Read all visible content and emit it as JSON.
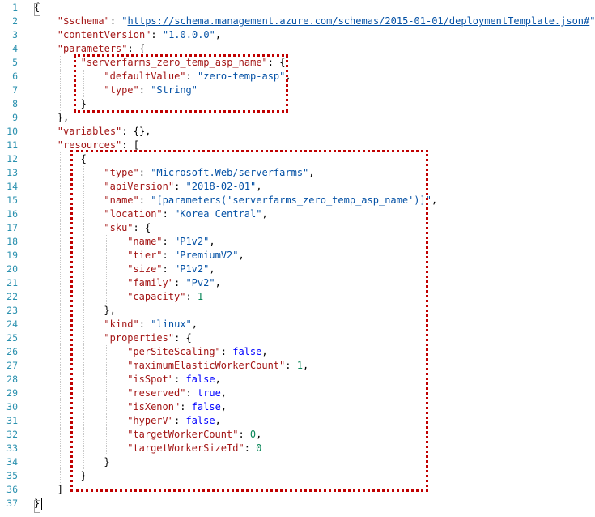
{
  "editor": {
    "language": "json",
    "line_numbers": [
      "1",
      "2",
      "3",
      "4",
      "5",
      "6",
      "7",
      "8",
      "9",
      "10",
      "11",
      "12",
      "13",
      "14",
      "15",
      "16",
      "17",
      "18",
      "19",
      "20",
      "21",
      "22",
      "23",
      "24",
      "25",
      "26",
      "27",
      "28",
      "29",
      "30",
      "31",
      "32",
      "33",
      "34",
      "35",
      "36",
      "37"
    ],
    "lines": [
      {
        "indent": 0,
        "tokens": [
          {
            "t": "p",
            "v": "{"
          }
        ]
      },
      {
        "indent": 1,
        "tokens": [
          {
            "t": "key",
            "v": "\"$schema\""
          },
          {
            "t": "p",
            "v": ": "
          },
          {
            "t": "str",
            "v": "\""
          },
          {
            "t": "url",
            "v": "https://schema.management.azure.com/schemas/2015-01-01/deploymentTemplate.json#"
          },
          {
            "t": "str",
            "v": "\""
          },
          {
            "t": "p",
            "v": ","
          }
        ]
      },
      {
        "indent": 1,
        "tokens": [
          {
            "t": "key",
            "v": "\"contentVersion\""
          },
          {
            "t": "p",
            "v": ": "
          },
          {
            "t": "str",
            "v": "\"1.0.0.0\""
          },
          {
            "t": "p",
            "v": ","
          }
        ]
      },
      {
        "indent": 1,
        "tokens": [
          {
            "t": "key",
            "v": "\"parameters\""
          },
          {
            "t": "p",
            "v": ": {"
          }
        ]
      },
      {
        "indent": 2,
        "tokens": [
          {
            "t": "key",
            "v": "\"serverfarms_zero_temp_asp_name\""
          },
          {
            "t": "p",
            "v": ": {"
          }
        ]
      },
      {
        "indent": 3,
        "tokens": [
          {
            "t": "key",
            "v": "\"defaultValue\""
          },
          {
            "t": "p",
            "v": ": "
          },
          {
            "t": "str",
            "v": "\"zero-temp-asp\""
          },
          {
            "t": "p",
            "v": ","
          }
        ]
      },
      {
        "indent": 3,
        "tokens": [
          {
            "t": "key",
            "v": "\"type\""
          },
          {
            "t": "p",
            "v": ": "
          },
          {
            "t": "str",
            "v": "\"String\""
          }
        ]
      },
      {
        "indent": 2,
        "tokens": [
          {
            "t": "p",
            "v": "}"
          }
        ]
      },
      {
        "indent": 1,
        "tokens": [
          {
            "t": "p",
            "v": "},"
          }
        ]
      },
      {
        "indent": 1,
        "tokens": [
          {
            "t": "key",
            "v": "\"variables\""
          },
          {
            "t": "p",
            "v": ": {},"
          }
        ]
      },
      {
        "indent": 1,
        "tokens": [
          {
            "t": "key",
            "v": "\"resources\""
          },
          {
            "t": "p",
            "v": ": ["
          }
        ]
      },
      {
        "indent": 2,
        "tokens": [
          {
            "t": "p",
            "v": "{"
          }
        ]
      },
      {
        "indent": 3,
        "tokens": [
          {
            "t": "key",
            "v": "\"type\""
          },
          {
            "t": "p",
            "v": ": "
          },
          {
            "t": "str",
            "v": "\"Microsoft.Web/serverfarms\""
          },
          {
            "t": "p",
            "v": ","
          }
        ]
      },
      {
        "indent": 3,
        "tokens": [
          {
            "t": "key",
            "v": "\"apiVersion\""
          },
          {
            "t": "p",
            "v": ": "
          },
          {
            "t": "str",
            "v": "\"2018-02-01\""
          },
          {
            "t": "p",
            "v": ","
          }
        ]
      },
      {
        "indent": 3,
        "tokens": [
          {
            "t": "key",
            "v": "\"name\""
          },
          {
            "t": "p",
            "v": ": "
          },
          {
            "t": "str",
            "v": "\"[parameters('serverfarms_zero_temp_asp_name')]\""
          },
          {
            "t": "p",
            "v": ","
          }
        ]
      },
      {
        "indent": 3,
        "tokens": [
          {
            "t": "key",
            "v": "\"location\""
          },
          {
            "t": "p",
            "v": ": "
          },
          {
            "t": "str",
            "v": "\"Korea Central\""
          },
          {
            "t": "p",
            "v": ","
          }
        ]
      },
      {
        "indent": 3,
        "tokens": [
          {
            "t": "key",
            "v": "\"sku\""
          },
          {
            "t": "p",
            "v": ": {"
          }
        ]
      },
      {
        "indent": 4,
        "tokens": [
          {
            "t": "key",
            "v": "\"name\""
          },
          {
            "t": "p",
            "v": ": "
          },
          {
            "t": "str",
            "v": "\"P1v2\""
          },
          {
            "t": "p",
            "v": ","
          }
        ]
      },
      {
        "indent": 4,
        "tokens": [
          {
            "t": "key",
            "v": "\"tier\""
          },
          {
            "t": "p",
            "v": ": "
          },
          {
            "t": "str",
            "v": "\"PremiumV2\""
          },
          {
            "t": "p",
            "v": ","
          }
        ]
      },
      {
        "indent": 4,
        "tokens": [
          {
            "t": "key",
            "v": "\"size\""
          },
          {
            "t": "p",
            "v": ": "
          },
          {
            "t": "str",
            "v": "\"P1v2\""
          },
          {
            "t": "p",
            "v": ","
          }
        ]
      },
      {
        "indent": 4,
        "tokens": [
          {
            "t": "key",
            "v": "\"family\""
          },
          {
            "t": "p",
            "v": ": "
          },
          {
            "t": "str",
            "v": "\"Pv2\""
          },
          {
            "t": "p",
            "v": ","
          }
        ]
      },
      {
        "indent": 4,
        "tokens": [
          {
            "t": "key",
            "v": "\"capacity\""
          },
          {
            "t": "p",
            "v": ": "
          },
          {
            "t": "num",
            "v": "1"
          }
        ]
      },
      {
        "indent": 3,
        "tokens": [
          {
            "t": "p",
            "v": "},"
          }
        ]
      },
      {
        "indent": 3,
        "tokens": [
          {
            "t": "key",
            "v": "\"kind\""
          },
          {
            "t": "p",
            "v": ": "
          },
          {
            "t": "str",
            "v": "\"linux\""
          },
          {
            "t": "p",
            "v": ","
          }
        ]
      },
      {
        "indent": 3,
        "tokens": [
          {
            "t": "key",
            "v": "\"properties\""
          },
          {
            "t": "p",
            "v": ": {"
          }
        ]
      },
      {
        "indent": 4,
        "tokens": [
          {
            "t": "key",
            "v": "\"perSiteScaling\""
          },
          {
            "t": "p",
            "v": ": "
          },
          {
            "t": "lit",
            "v": "false"
          },
          {
            "t": "p",
            "v": ","
          }
        ]
      },
      {
        "indent": 4,
        "tokens": [
          {
            "t": "key",
            "v": "\"maximumElasticWorkerCount\""
          },
          {
            "t": "p",
            "v": ": "
          },
          {
            "t": "num",
            "v": "1"
          },
          {
            "t": "p",
            "v": ","
          }
        ]
      },
      {
        "indent": 4,
        "tokens": [
          {
            "t": "key",
            "v": "\"isSpot\""
          },
          {
            "t": "p",
            "v": ": "
          },
          {
            "t": "lit",
            "v": "false"
          },
          {
            "t": "p",
            "v": ","
          }
        ]
      },
      {
        "indent": 4,
        "tokens": [
          {
            "t": "key",
            "v": "\"reserved\""
          },
          {
            "t": "p",
            "v": ": "
          },
          {
            "t": "lit",
            "v": "true"
          },
          {
            "t": "p",
            "v": ","
          }
        ]
      },
      {
        "indent": 4,
        "tokens": [
          {
            "t": "key",
            "v": "\"isXenon\""
          },
          {
            "t": "p",
            "v": ": "
          },
          {
            "t": "lit",
            "v": "false"
          },
          {
            "t": "p",
            "v": ","
          }
        ]
      },
      {
        "indent": 4,
        "tokens": [
          {
            "t": "key",
            "v": "\"hyperV\""
          },
          {
            "t": "p",
            "v": ": "
          },
          {
            "t": "lit",
            "v": "false"
          },
          {
            "t": "p",
            "v": ","
          }
        ]
      },
      {
        "indent": 4,
        "tokens": [
          {
            "t": "key",
            "v": "\"targetWorkerCount\""
          },
          {
            "t": "p",
            "v": ": "
          },
          {
            "t": "num",
            "v": "0"
          },
          {
            "t": "p",
            "v": ","
          }
        ]
      },
      {
        "indent": 4,
        "tokens": [
          {
            "t": "key",
            "v": "\"targetWorkerSizeId\""
          },
          {
            "t": "p",
            "v": ": "
          },
          {
            "t": "num",
            "v": "0"
          }
        ]
      },
      {
        "indent": 3,
        "tokens": [
          {
            "t": "p",
            "v": "}"
          }
        ]
      },
      {
        "indent": 2,
        "tokens": [
          {
            "t": "p",
            "v": "}"
          }
        ]
      },
      {
        "indent": 1,
        "tokens": [
          {
            "t": "p",
            "v": "]"
          }
        ]
      },
      {
        "indent": 0,
        "tokens": [
          {
            "t": "p",
            "v": "}"
          }
        ]
      }
    ]
  },
  "colors": {
    "line_number": "#2b91af",
    "property_key": "#a31515",
    "string_value": "#0451a5",
    "number_value": "#098658",
    "literal_value": "#0000ff",
    "highlight_box": "#c00000"
  }
}
